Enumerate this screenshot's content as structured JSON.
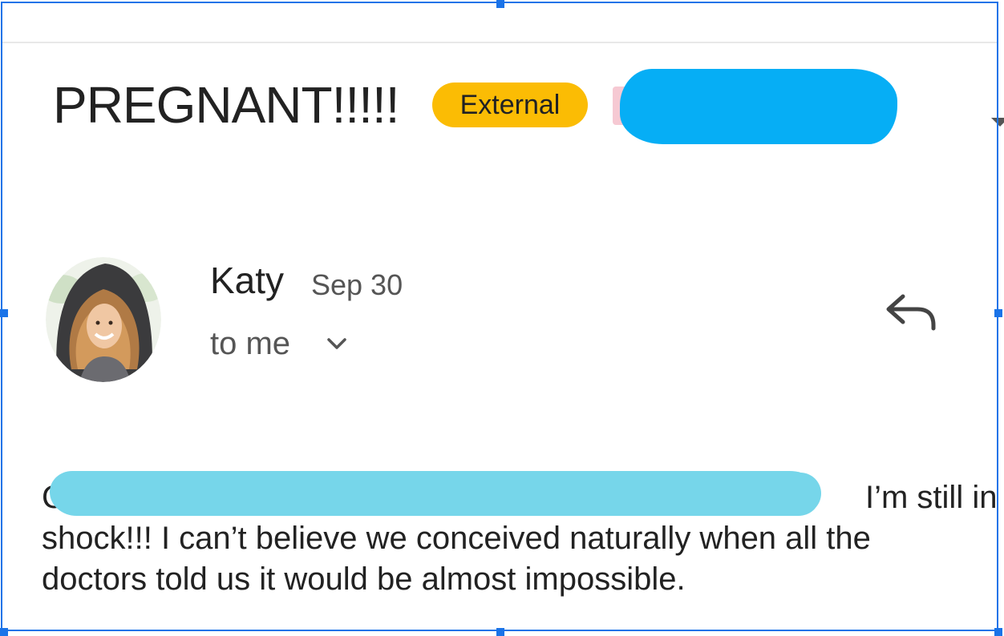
{
  "subject": "PREGNANT!!!!!",
  "badge_label": "External",
  "sender": {
    "name": "Katy",
    "date": "Sep 30",
    "recipient": "to me"
  },
  "body": {
    "line1_visible_start": "C",
    "line1_visible_end": "I’m still in",
    "line2": "shock!!! I can’t believe we conceived naturally when all the",
    "line3": "doctors told us it would be almost impossible."
  },
  "icons": {
    "avatar": "avatar",
    "reply": "reply-icon",
    "recipient_expand": "chevron-down-icon",
    "more": "chevron-down-icon"
  },
  "colors": {
    "badge": "#fbbc04",
    "selection_frame": "#1a73e8",
    "redaction_subject": "#06aef5",
    "redaction_body": "#76d6ea"
  }
}
